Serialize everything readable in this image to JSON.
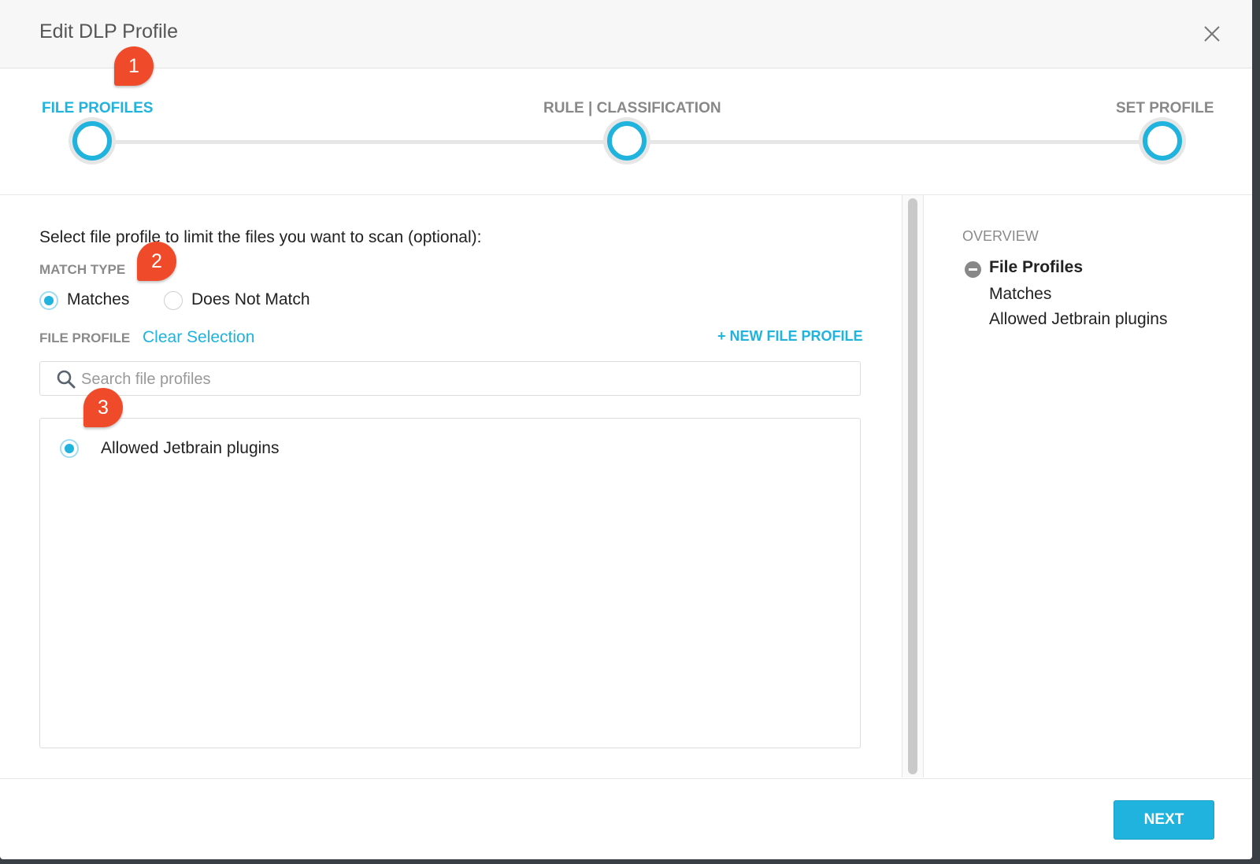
{
  "dialog": {
    "title": "Edit DLP Profile"
  },
  "steps": [
    {
      "label": "FILE PROFILES",
      "active": true
    },
    {
      "label": "RULE | CLASSIFICATION",
      "active": false
    },
    {
      "label": "SET PROFILE",
      "active": false
    }
  ],
  "main": {
    "instructions": "Select file profile to limit the files you want to scan (optional):",
    "match_type_label": "MATCH TYPE",
    "match_options": [
      {
        "label": "Matches",
        "selected": true
      },
      {
        "label": "Does Not Match",
        "selected": false
      }
    ],
    "file_profile_label": "FILE PROFILE",
    "clear_selection": "Clear Selection",
    "new_file_profile": "+ NEW FILE PROFILE",
    "search": {
      "placeholder": "Search file profiles",
      "value": ""
    },
    "profiles": [
      {
        "label": "Allowed Jetbrain plugins",
        "selected": true
      }
    ]
  },
  "overview": {
    "title": "OVERVIEW",
    "heading": "File Profiles",
    "lines": [
      "Matches",
      "Allowed Jetbrain plugins"
    ]
  },
  "footer": {
    "next_label": "NEXT"
  },
  "markers": [
    "1",
    "2",
    "3"
  ],
  "colors": {
    "accent": "#1fb3dd",
    "marker": "#ef4b2b"
  }
}
